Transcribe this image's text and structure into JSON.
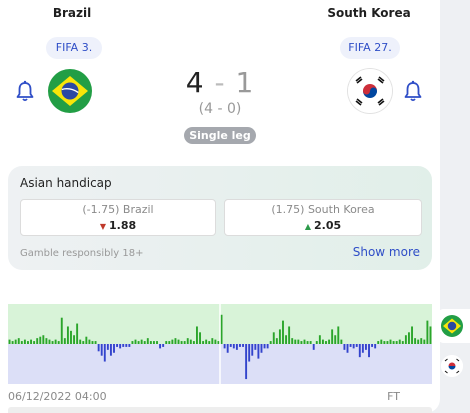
{
  "match": {
    "home_team": "Brazil",
    "away_team": "South Korea",
    "home_rank": "FIFA 3.",
    "away_rank": "FIFA 27.",
    "home_score": "4",
    "away_score": "1",
    "score_separator": "-",
    "aggregate": "(4 - 0)",
    "leg_type": "Single leg"
  },
  "odds": {
    "title": "Asian handicap",
    "home_label": "(-1.75) Brazil",
    "home_value": "1.88",
    "home_trend": "down",
    "away_label": "(1.75) South Korea",
    "away_value": "2.05",
    "away_trend": "up",
    "disclaimer": "Gamble responsibly 18+",
    "show_more": "Show more"
  },
  "momentum": {
    "start_label": "06/12/2022 04:00",
    "end_label": "FT",
    "colors": {
      "home": "#2aa52a",
      "away": "#3344cc",
      "home_bg": "#d8f3d8",
      "away_bg": "#dcdff7"
    },
    "values": [
      3,
      2,
      3,
      4,
      2,
      3,
      2,
      3,
      2,
      4,
      5,
      6,
      4,
      3,
      2,
      3,
      2,
      18,
      4,
      12,
      9,
      6,
      14,
      3,
      2,
      5,
      3,
      2,
      2,
      -5,
      -8,
      -12,
      -4,
      -8,
      -6,
      -2,
      -3,
      -2,
      -2,
      -2,
      2,
      3,
      2,
      3,
      2,
      4,
      2,
      2,
      2,
      -3,
      -2,
      2,
      2,
      3,
      4,
      3,
      2,
      2,
      4,
      3,
      2,
      12,
      8,
      2,
      3,
      2,
      4,
      3,
      2,
      20,
      -3,
      -6,
      -2,
      -3,
      -4,
      -2,
      -2,
      -24,
      -12,
      -8,
      -4,
      -10,
      -6,
      -3,
      -3,
      2,
      8,
      4,
      10,
      16,
      6,
      12,
      4,
      3,
      3,
      2,
      3,
      2,
      2,
      -4,
      2,
      6,
      3,
      2,
      3,
      10,
      6,
      12,
      3,
      -4,
      -6,
      -2,
      -3,
      -2,
      -9,
      -6,
      -4,
      -9,
      -2,
      -3,
      2,
      3,
      2,
      2,
      3,
      2,
      2,
      3,
      2,
      6,
      8,
      12,
      4,
      3,
      4,
      3,
      16,
      12
    ]
  },
  "icons": {
    "bell": "bell-icon",
    "home_flag": "brazil-flag-icon",
    "away_flag": "south-korea-flag-icon"
  }
}
